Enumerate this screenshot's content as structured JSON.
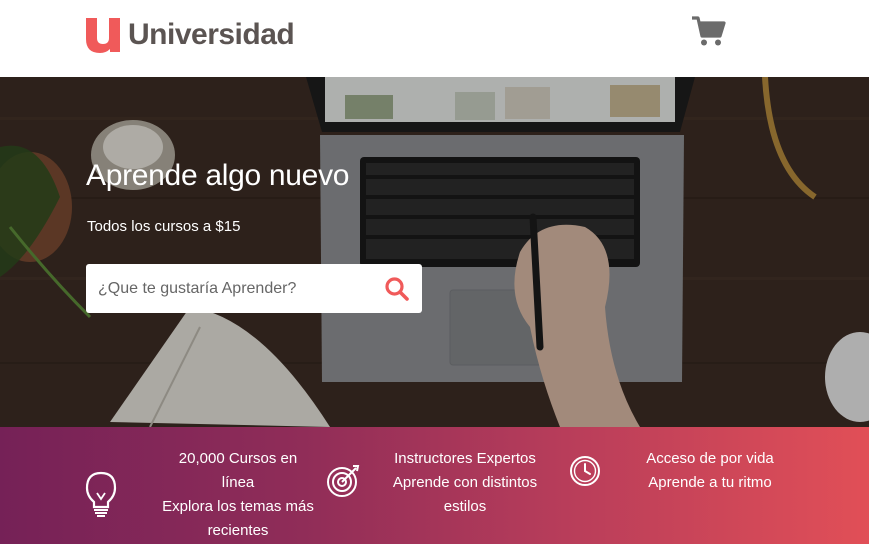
{
  "header": {
    "logo_text": "Universidad",
    "logo_icon": "u-logo-mark",
    "cart_icon": "cart-icon"
  },
  "hero": {
    "title": "Aprende algo nuevo",
    "subtitle": "Todos los cursos a $15",
    "search": {
      "placeholder": "¿Que te gustaría Aprender?",
      "value": "",
      "icon": "search-icon"
    }
  },
  "features": [
    {
      "icon": "lightbulb-icon",
      "line1": "20,000 Cursos en",
      "line2": "línea",
      "line3": "Explora los temas más",
      "line4": "recientes"
    },
    {
      "icon": "target-icon",
      "line1": "Instructores Expertos",
      "line2": "Aprende con distintos",
      "line3": "estilos"
    },
    {
      "icon": "clock-icon",
      "line1": "Acceso de por vida",
      "line2": "Aprende a tu ritmo"
    }
  ],
  "colors": {
    "brand_red": "#f05a5a",
    "logo_text": "#5b5452",
    "cart_gray": "#6b6b6b",
    "features_gradient_start": "#752157",
    "features_gradient_end": "#e14f57"
  }
}
